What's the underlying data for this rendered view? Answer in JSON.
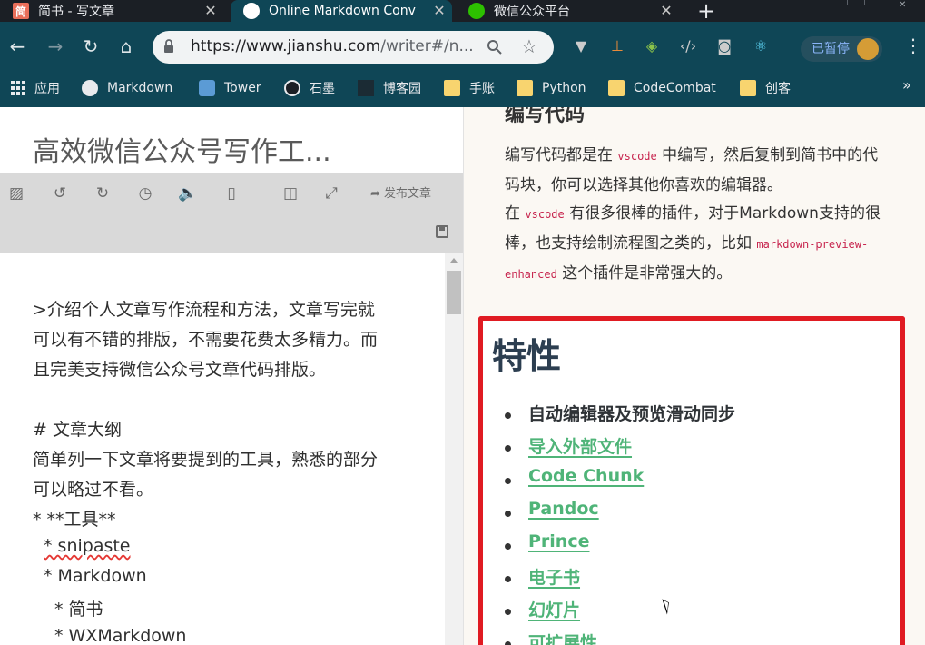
{
  "browser": {
    "tabs": [
      {
        "icon": "jianshu-icon",
        "fav_text": "简",
        "title": "简书 - 写文章",
        "close": "✕"
      },
      {
        "icon": "markdown-icon",
        "title": "Online Markdown Conv",
        "close": "✕"
      },
      {
        "icon": "wechat-icon",
        "title": "微信公众平台",
        "close": "✕"
      }
    ],
    "new_tab": "+",
    "url_host": "https://www.jianshu.com",
    "url_path": "/writer#/n...",
    "paused_label": "已暂停",
    "bookmarks": [
      {
        "label": "应用",
        "icon": "apps-icon"
      },
      {
        "label": "Markdown",
        "icon": "markdown-icon"
      },
      {
        "label": "Tower",
        "icon": "tower-icon"
      },
      {
        "label": "石墨",
        "icon": "shimo-icon"
      },
      {
        "label": "博客园",
        "icon": "cnblogs-icon"
      },
      {
        "label": "手账",
        "icon": "folder-icon"
      },
      {
        "label": "Python",
        "icon": "folder-icon"
      },
      {
        "label": "CodeCombat",
        "icon": "folder-icon"
      },
      {
        "label": "创客",
        "icon": "folder-icon"
      }
    ],
    "colors": {
      "toolbar": "#0f4656",
      "tabstrip": "#1b1f25",
      "link_green": "#4fb478",
      "highlight_red": "#e01b22"
    }
  },
  "editor": {
    "doc_title": "高效微信公众号写作工...",
    "publish_label": "发布文章",
    "lines": [
      ">介绍个人文章写作流程和方法，文章写完就",
      "可以有不错的排版，不需要花费太多精力。而",
      "且完美支持微信公众号文章代码排版。",
      "",
      "# 文章大纲",
      "简单列一下文章将要提到的工具，熟悉的部分",
      "可以略过不看。",
      "* **工具**",
      "  * snipaste",
      "  * Markdown",
      "    * 简书",
      "    * WXMarkdown"
    ]
  },
  "preview": {
    "cut_heading": "编写代码",
    "para1_a": "编写代码都是在 ",
    "para1_code": "vscode",
    "para1_b": " 中编写，然后复制到简书中的代码块，你可以选择其他你喜欢的编辑器。",
    "para2_a": "在 ",
    "para2_code": "vscode",
    "para2_b": " 有很多很棒的插件，对于Markdown支持的很棒，也支持绘制流程图之类的，比如 ",
    "para2_code2": "markdown-preview-enhanced",
    "para2_c": " 这个插件是非常强大的。",
    "features_heading": "特性",
    "features": [
      {
        "label": "自动编辑器及预览滑动同步",
        "link": false
      },
      {
        "label": "导入外部文件",
        "link": true
      },
      {
        "label": "Code Chunk",
        "link": true
      },
      {
        "label": "Pandoc",
        "link": true
      },
      {
        "label": "Prince",
        "link": true
      },
      {
        "label": "电子书",
        "link": true
      },
      {
        "label": "幻灯片",
        "link": true
      },
      {
        "label": "可扩展性",
        "link": true
      }
    ]
  }
}
